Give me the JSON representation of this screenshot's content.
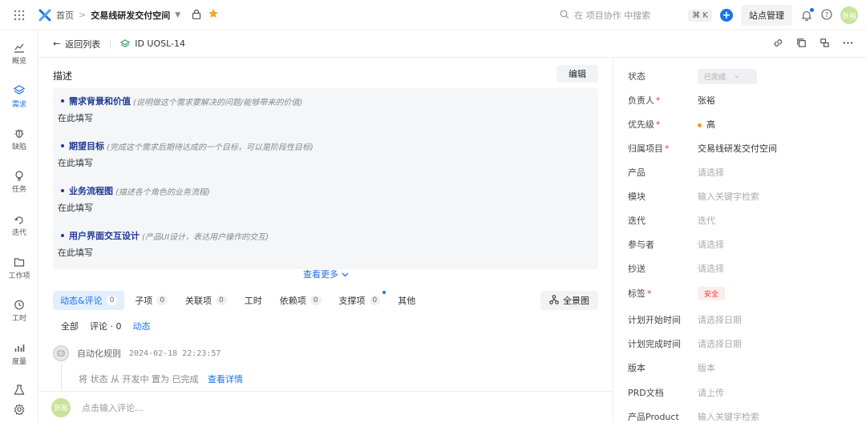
{
  "topbar": {
    "breadcrumb_home": "首页",
    "breadcrumb_sep": ">",
    "space_name": "交易线研发交付空间",
    "search_placeholder": "在 项目协作 中搜索",
    "shortcut": "⌘ K",
    "plus": "+",
    "site_admin": "站点管理",
    "user_avatar": "张裕"
  },
  "leftnav": [
    {
      "label": "概览",
      "icon": "chart-icon"
    },
    {
      "label": "需求",
      "icon": "layers-icon",
      "active": true
    },
    {
      "label": "缺陷",
      "icon": "bug-icon"
    },
    {
      "label": "任务",
      "icon": "bulb-icon"
    },
    {
      "label": "迭代",
      "icon": "iteration-icon"
    },
    {
      "label": "工作项",
      "icon": "folder-icon"
    },
    {
      "label": "工时",
      "icon": "clock-icon"
    },
    {
      "label": "度量",
      "icon": "bar-chart-icon"
    }
  ],
  "subheader": {
    "back_label": "返回列表",
    "id_label": "ID UOSL-14"
  },
  "description": {
    "title": "描述",
    "edit_label": "编辑",
    "sections": [
      {
        "title": "需求背景和价值",
        "hint": "(说明做这个需求要解决的问题/能够带来的价值)",
        "body": "在此填写"
      },
      {
        "title": "期望目标",
        "hint": "(完成这个需求后期待达成的一个目标，可以是阶段性目标)",
        "body": "在此填写"
      },
      {
        "title": "业务流程图",
        "hint": "(描述各个角色的业务流程)",
        "body": "在此填写"
      },
      {
        "title": "用户界面交互设计",
        "hint": "(产品UI设计，表达用户操作的交互)",
        "body": "在此填写"
      }
    ],
    "see_more": "查看更多"
  },
  "tabs": [
    {
      "label": "动态&评论",
      "count": "0",
      "active": true
    },
    {
      "label": "子项",
      "count": "0"
    },
    {
      "label": "关联项",
      "count": "0"
    },
    {
      "label": "工时",
      "count": ""
    },
    {
      "label": "依赖项",
      "count": "0"
    },
    {
      "label": "支撑项",
      "count": "0",
      "dot": true
    },
    {
      "label": "其他",
      "count": ""
    }
  ],
  "panorama_label": "全景图",
  "subtabs": {
    "all": "全部",
    "comments": "评论 · 0",
    "activity": "动态"
  },
  "activity": {
    "actor": "自动化规则",
    "time": "2024-02-18 22:23:57",
    "text": "将 状态 从 开发中 置为 已完成",
    "link": "查看详情"
  },
  "comment": {
    "avatar": "张裕",
    "placeholder": "点击输入评论..."
  },
  "properties": [
    {
      "key": "状态",
      "value": "已完成",
      "type": "status"
    },
    {
      "key": "负责人",
      "required": true,
      "value": "张裕"
    },
    {
      "key": "优先级",
      "required": true,
      "value": "高",
      "type": "priority"
    },
    {
      "key": "归属项目",
      "required": true,
      "value": "交易线研发交付空间"
    },
    {
      "key": "产品",
      "placeholder": "请选择"
    },
    {
      "key": "模块",
      "placeholder": "输入关键字检索"
    },
    {
      "key": "迭代",
      "placeholder": "迭代"
    },
    {
      "key": "参与者",
      "placeholder": "请选择"
    },
    {
      "key": "抄送",
      "placeholder": "请选择"
    },
    {
      "key": "标签",
      "required": true,
      "value": "安全",
      "type": "tag"
    },
    {
      "key": "计划开始时间",
      "placeholder": "请选择日期"
    },
    {
      "key": "计划完成时间",
      "placeholder": "请选择日期"
    },
    {
      "key": "版本",
      "placeholder": "版本"
    },
    {
      "key": "PRD文档",
      "placeholder": "请上传"
    },
    {
      "key": "产品Product",
      "placeholder": "输入关键字检索"
    }
  ],
  "colors": {
    "accent": "#1a73e8",
    "title_blue": "#1f3a93",
    "required": "#e53935",
    "priority_high": "#f39c12"
  }
}
